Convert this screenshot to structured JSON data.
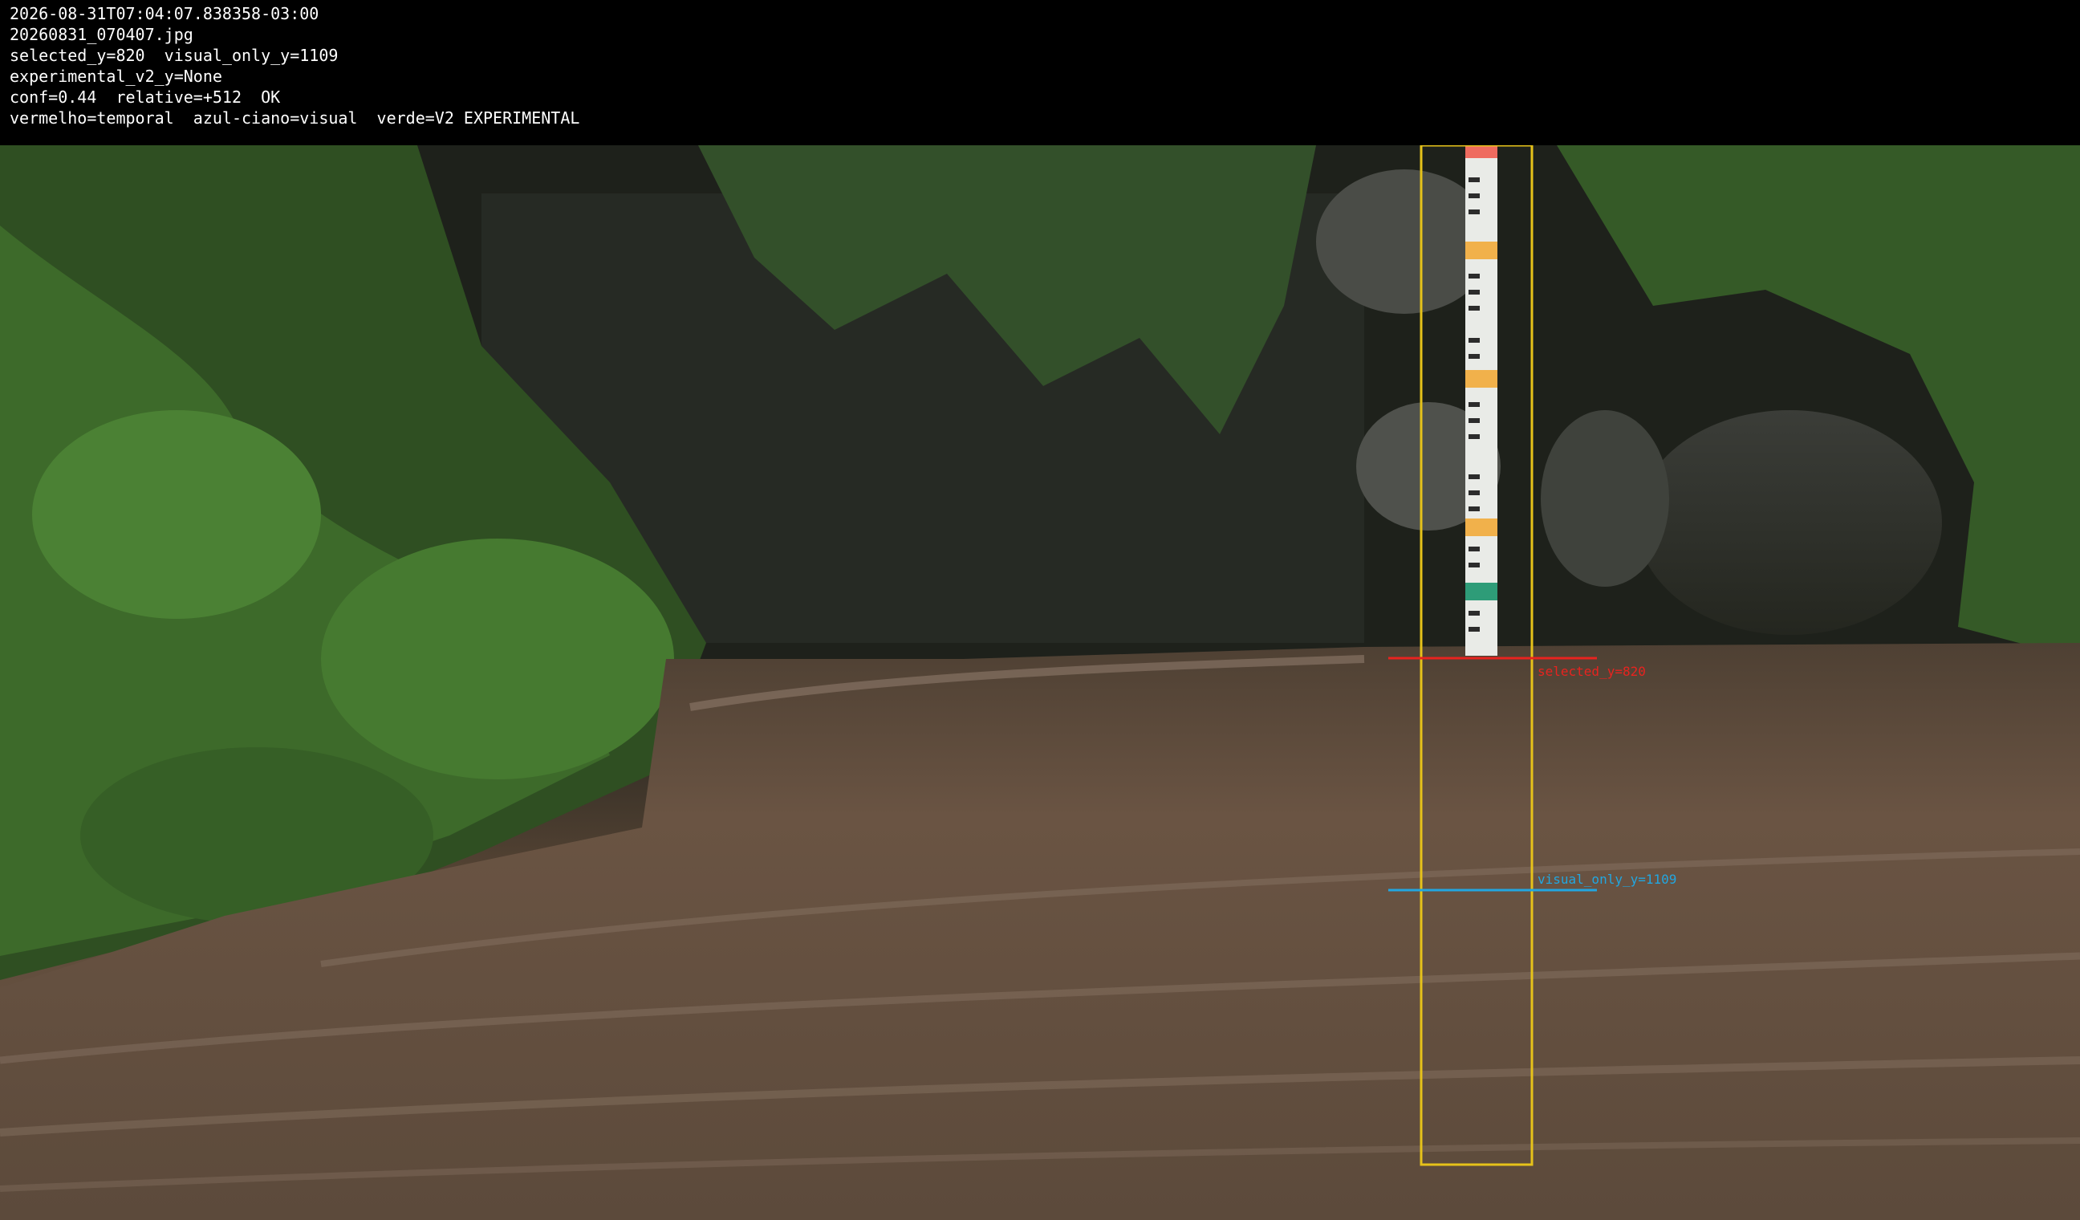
{
  "overlay_header": {
    "lines": [
      "2026-08-31T07:04:07.838358-03:00",
      "20260831_070407.jpg",
      "selected_y=820  visual_only_y=1109",
      "experimental_v2_y=None",
      "conf=0.44  relative=+512  OK",
      "vermelho=temporal  azul-ciano=visual  verde=V2 EXPERIMENTAL"
    ]
  },
  "markers": {
    "selected_label": "selected_y=820",
    "visual_label": "visual_only_y=1109",
    "selected_color": "#e8231f",
    "visual_color": "#22a6e0",
    "roi_color": "#e6c21a"
  },
  "colors": {
    "header_bg": "#000000",
    "header_text": "#ffffff",
    "water": "#6b5646",
    "foliage": "#3d6a2a"
  }
}
